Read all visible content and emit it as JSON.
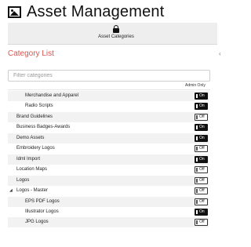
{
  "app": {
    "title": "Asset Management",
    "icon": "image-icon"
  },
  "tabs": [
    {
      "label": "Asset Categories",
      "icon": "lock-icon",
      "active": true
    }
  ],
  "section": {
    "title": "Category List",
    "title_color": "#d9534f"
  },
  "filter": {
    "placeholder": "Filter categories",
    "value": ""
  },
  "table": {
    "column_header": "Admin Only"
  },
  "toggle_labels": {
    "on": "On",
    "off": "Off"
  },
  "categories": [
    {
      "label": "Merchandise and Apparel",
      "level": 2,
      "admin_only": true
    },
    {
      "label": "Radio Scripts",
      "level": 2,
      "admin_only": true
    },
    {
      "label": "Brand Guidelines",
      "level": 1,
      "admin_only": false
    },
    {
      "label": "Business Badges-Awards",
      "level": 1,
      "admin_only": true
    },
    {
      "label": "Demo Assets",
      "level": 1,
      "admin_only": true
    },
    {
      "label": "Embroidery Logos",
      "level": 1,
      "admin_only": false
    },
    {
      "label": "Idml Import",
      "level": 1,
      "admin_only": true
    },
    {
      "label": "Location Maps",
      "level": 1,
      "admin_only": false
    },
    {
      "label": "Logos",
      "level": 1,
      "admin_only": false
    },
    {
      "label": "Logos - Master",
      "level": 1,
      "admin_only": false,
      "expanded": true
    },
    {
      "label": "EPS PDF Logos",
      "level": 2,
      "admin_only": false
    },
    {
      "label": "Illustrator Logos",
      "level": 2,
      "admin_only": true
    },
    {
      "label": "JPG Logos",
      "level": 2,
      "admin_only": false
    }
  ]
}
